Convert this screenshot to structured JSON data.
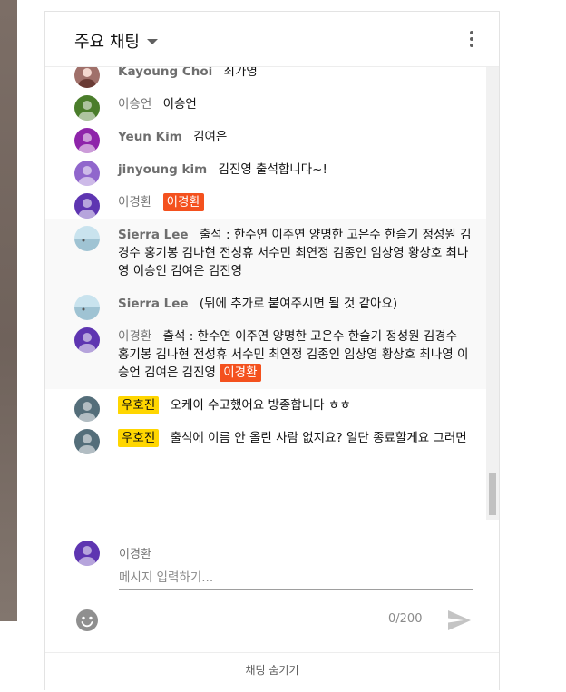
{
  "header": {
    "title": "주요 채팅",
    "dropdown_icon": "caret-down-icon",
    "menu_icon": "more-vert-icon"
  },
  "messages": [
    {
      "author": "Kayoung Choi",
      "text": "최가영",
      "avatar_color": "#a0706a"
    },
    {
      "author": "이승언",
      "text": "이승언",
      "avatar_color": "#4a7d2b"
    },
    {
      "author": "Yeun Kim",
      "text": "김여은",
      "avatar_color": "#8e24aa"
    },
    {
      "author": "jinyoung kim",
      "text": "김진영 출석합니다~!",
      "avatar_color": "#9066cc"
    },
    {
      "author": "이경환",
      "text": "",
      "owner_badge": "이경환",
      "avatar_color": "#5e35b1"
    },
    {
      "author": "Sierra Lee",
      "text": "출석 : 한수연 이주연 양명한 고은수 한슬기 정성원 김경수 홍기봉 김나현 전성휴 서수민 최연정 김종인 임상영 황상호 최나영 이승언 김여은 김진영",
      "avatar_color": "#b5d3e0"
    },
    {
      "author": "Sierra Lee",
      "text": "(뒤에 추가로 붙여주시면 될 것 같아요)",
      "avatar_color": "#b5d3e0"
    },
    {
      "author": "이경환",
      "text": "출석 : 한수연 이주연 양명한 고은수 한슬기 정성원 김경수 홍기봉 김나현 전성휴 서수민 최연정 김종인 임상영 황상호 최나영 이승언 김여은 김진영",
      "owner_badge": "이경환",
      "avatar_color": "#5e35b1"
    },
    {
      "moderator_badge": "우호진",
      "text": "오케이 수고했어요 방종합니다 ㅎㅎ",
      "avatar_color": "#546e7a"
    },
    {
      "moderator_badge": "우호진",
      "text": "출석에 이름 안 올린 사람 없지요? 일단 종료할게요 그러면",
      "avatar_color": "#546e7a"
    }
  ],
  "composer": {
    "user_name": "이경환",
    "placeholder": "메시지 입력하기...",
    "counter": "0/200",
    "emoji_icon": "emoji-icon",
    "send_icon": "send-icon",
    "avatar_color": "#5e35b1"
  },
  "footer": {
    "hide_chat_label": "채팅 숨기기"
  }
}
